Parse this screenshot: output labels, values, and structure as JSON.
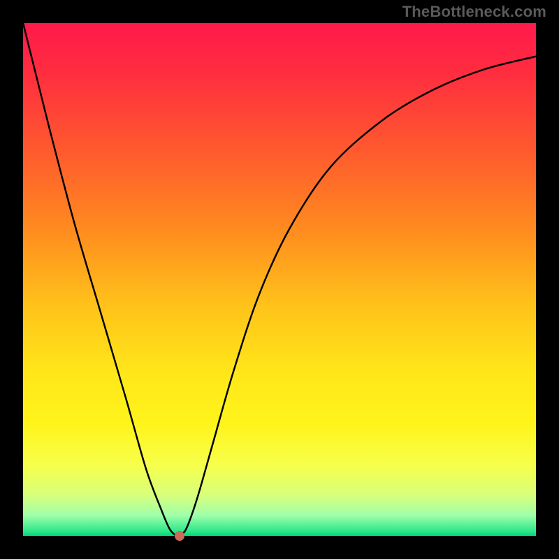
{
  "watermark": "TheBottleneck.com",
  "chart_data": {
    "type": "line",
    "title": "",
    "xlabel": "",
    "ylabel": "",
    "xlim": [
      0,
      1
    ],
    "ylim": [
      0,
      1
    ],
    "background": {
      "type": "vertical-gradient",
      "stops": [
        {
          "pos": 0.0,
          "color": "#ff1a4b"
        },
        {
          "pos": 0.1,
          "color": "#ff2e3f"
        },
        {
          "pos": 0.25,
          "color": "#ff5a2e"
        },
        {
          "pos": 0.4,
          "color": "#ff8a1f"
        },
        {
          "pos": 0.55,
          "color": "#ffc21a"
        },
        {
          "pos": 0.68,
          "color": "#ffe61a"
        },
        {
          "pos": 0.78,
          "color": "#fff41a"
        },
        {
          "pos": 0.86,
          "color": "#f7ff4a"
        },
        {
          "pos": 0.92,
          "color": "#d8ff7a"
        },
        {
          "pos": 0.96,
          "color": "#9fffaa"
        },
        {
          "pos": 0.99,
          "color": "#30e88a"
        },
        {
          "pos": 1.0,
          "color": "#00d47a"
        }
      ]
    },
    "series": [
      {
        "name": "bottleneck-curve",
        "x": [
          0.0,
          0.015,
          0.05,
          0.1,
          0.15,
          0.2,
          0.24,
          0.27,
          0.285,
          0.295,
          0.302,
          0.31,
          0.32,
          0.34,
          0.37,
          0.41,
          0.46,
          0.52,
          0.6,
          0.7,
          0.8,
          0.9,
          1.0
        ],
        "y": [
          1.0,
          0.94,
          0.8,
          0.61,
          0.44,
          0.27,
          0.13,
          0.05,
          0.015,
          0.003,
          0.0,
          0.004,
          0.018,
          0.075,
          0.18,
          0.32,
          0.47,
          0.6,
          0.72,
          0.81,
          0.87,
          0.91,
          0.935
        ],
        "color": "#000000",
        "width": 2.5
      }
    ],
    "marker": {
      "x": 0.305,
      "y": 0.0,
      "color": "#c96a5a"
    },
    "grid": false,
    "legend": false
  }
}
